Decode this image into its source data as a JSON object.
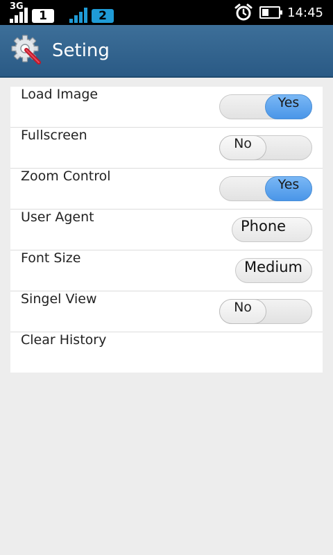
{
  "status_bar": {
    "network_type": "3G",
    "sim1_label": "1",
    "sim2_label": "2",
    "time": "14:45",
    "icons": [
      "signal-icon",
      "alarm-clock-icon",
      "battery-icon"
    ],
    "colors": {
      "sim2_accent": "#1f9bd6"
    }
  },
  "header": {
    "title": "Seting",
    "icon": "settings-gear-wrench-icon",
    "background": "#2f6390"
  },
  "settings": {
    "load_image": {
      "label": "Load Image",
      "value": "Yes",
      "state": "on"
    },
    "fullscreen": {
      "label": "Fullscreen",
      "value": "No",
      "state": "off"
    },
    "zoom_control": {
      "label": "Zoom Control",
      "value": "Yes",
      "state": "on"
    },
    "user_agent": {
      "label": "User Agent",
      "value": "Phone"
    },
    "font_size": {
      "label": "Font Size",
      "value": "Medium"
    },
    "single_view": {
      "label": "Singel View",
      "value": "No",
      "state": "off"
    },
    "clear_history": {
      "label": "Clear History"
    }
  },
  "colors": {
    "toggle_on": "#5aa3ee",
    "page_background": "#ededed"
  }
}
